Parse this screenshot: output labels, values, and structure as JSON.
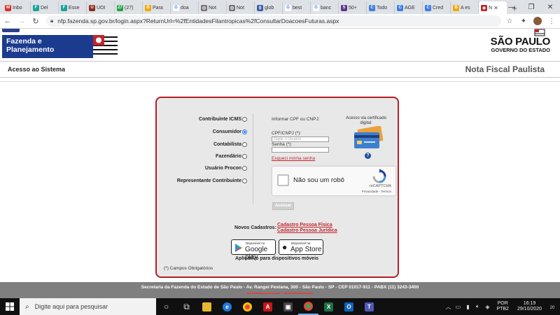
{
  "browser": {
    "tabs": [
      {
        "label": "Inbo",
        "icon": "gmail-icon",
        "color": "#d93025",
        "glyph": "M"
      },
      {
        "label": "Del",
        "icon": "teal-square-icon",
        "color": "#1aa39a",
        "glyph": "F"
      },
      {
        "label": "Esse",
        "icon": "teal-square-icon",
        "color": "#1aa39a",
        "glyph": "F"
      },
      {
        "label": "UOI",
        "icon": "uol-icon",
        "color": "#8b2c1c",
        "glyph": "U"
      },
      {
        "label": "(27)",
        "icon": "whatsapp-icon",
        "color": "#25a244",
        "glyph": "27"
      },
      {
        "label": "Para",
        "icon": "orange-square-icon",
        "color": "#f2a900",
        "glyph": "B"
      },
      {
        "label": "doa",
        "icon": "google-icon",
        "color": "#ffffff",
        "glyph": "G"
      },
      {
        "label": "Not",
        "icon": "globe-icon",
        "color": "#777777",
        "glyph": "◎"
      },
      {
        "label": "Not",
        "icon": "globe-icon",
        "color": "#777777",
        "glyph": "◎"
      },
      {
        "label": "glob",
        "icon": "g1-icon",
        "color": "#3b5fa8",
        "glyph": "g"
      },
      {
        "label": "best",
        "icon": "google-icon",
        "color": "#ffffff",
        "glyph": "G"
      },
      {
        "label": "banc",
        "icon": "google-icon",
        "color": "#ffffff",
        "glyph": "G"
      },
      {
        "label": "50+",
        "icon": "fifty-icon",
        "color": "#5b3a8a",
        "glyph": "5"
      },
      {
        "label": "Todo",
        "icon": "c-circle-icon",
        "color": "#3d7de0",
        "glyph": "C"
      },
      {
        "label": "AGE",
        "icon": "c-circle-icon",
        "color": "#3d7de0",
        "glyph": "C"
      },
      {
        "label": "Cred",
        "icon": "c-circle-icon",
        "color": "#3d7de0",
        "glyph": "C"
      },
      {
        "label": "A es",
        "icon": "orange-square-icon",
        "color": "#f2a900",
        "glyph": "B"
      },
      {
        "label": "N",
        "icon": "nfp-icon",
        "color": "#c0262d",
        "glyph": "◆",
        "active": true
      }
    ],
    "url": "nfp.fazenda.sp.gov.br/login.aspx?ReturnUrl=%2fEntidadesFilantropicas%2fConsultarDoacoesFuturas.aspx"
  },
  "site": {
    "logo_line1": "Fazenda e",
    "logo_line2": "Planejamento",
    "sp_name": "SÃO PAULO",
    "sp_sub": "GOVERNO DO ESTADO",
    "access_title": "Acesso ao Sistema",
    "system_title": "Nota Fiscal Paulista"
  },
  "login": {
    "options": [
      {
        "label": "Contribuinte ICMS",
        "selected": false
      },
      {
        "label": "Consumidor",
        "selected": true
      },
      {
        "label": "Contabilista",
        "selected": false
      },
      {
        "label": "Fazendário",
        "selected": false
      },
      {
        "label": "Usuário Procon",
        "selected": false
      },
      {
        "label": "Representante Contribuinte",
        "selected": false
      }
    ],
    "info_text": "Informar CPF ou CNPJ:",
    "cpf_label": "CPF/CNPJ (*):",
    "cpf_placeholder": "Digite o Usuário",
    "senha_label": "Senha (*):",
    "forgot": "Esqueci minha senha",
    "cert_text": "Acesso via certificado digital:",
    "help": "?",
    "captcha_label": "Não sou um robô",
    "captcha_brand": "reCAPTCHA",
    "captcha_links": "Privacidade - Termos",
    "submit": "Acessar",
    "novos_label": "Novos Cadastros:",
    "novo_fisica": "Cadastro Pessoa Física",
    "novo_juridica": "Cadastro Pessoa Jurídica",
    "gp_small": "Disponível no",
    "gp_big": "Google play",
    "as_small": "Disponível na",
    "as_big": "App Store",
    "apps_label": "Aplicativo para dispositivos móveis",
    "required": "(*) Campos Obrigatórios"
  },
  "footer": {
    "text": "Secretaria da Fazenda do Estado de São Paulo - Av. Rangel Pestana, 300 - São Paulo - SP - CEP 01017-911 - PABX (11) 3243-3400"
  },
  "taskbar": {
    "search_placeholder": "Digite aqui para pesquisar",
    "lang1": "POR",
    "lang2": "PTB2",
    "time": "16:19",
    "date": "29/10/2020",
    "notif": "20"
  },
  "colors": {
    "brand_blue": "#1b3b8f",
    "accent_red": "#c0262d",
    "panel_border": "#b32027"
  }
}
